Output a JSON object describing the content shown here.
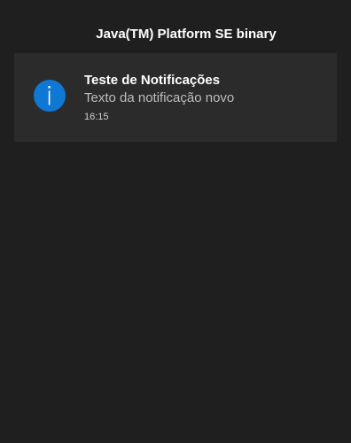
{
  "app": {
    "title": "Java(TM) Platform SE binary"
  },
  "notification": {
    "icon": "info-icon",
    "title": "Teste de Notificações",
    "body": "Texto da notificação novo",
    "time": "16:15"
  },
  "colors": {
    "background": "#1f1f1f",
    "card": "#2b2b2b",
    "accent": "#0f78d4"
  }
}
